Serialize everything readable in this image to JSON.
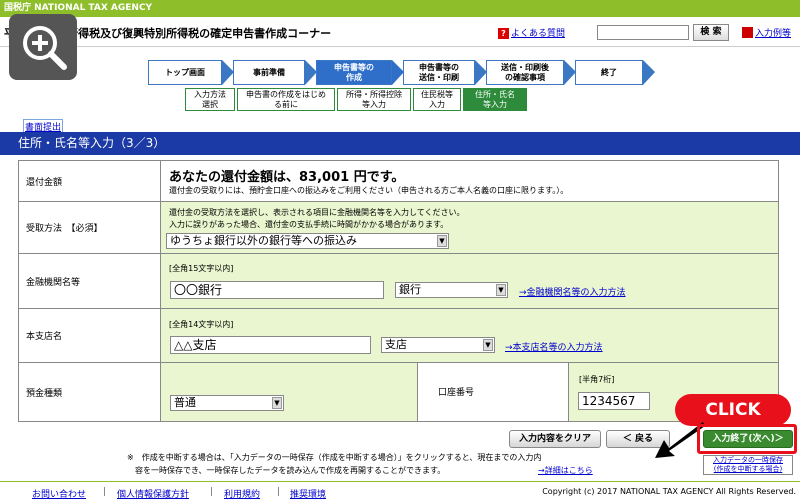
{
  "header": {
    "agency": "国税庁 NATIONAL TAX AGENCY",
    "app_title": "平成29年分 所得税及び復興特別所得税の確定申告書作成コーナー",
    "faq": "よくある質問",
    "search_button": "検 索",
    "input_example": "入力例等"
  },
  "steps": [
    "トップ画面",
    "事前準備",
    "申告書等の\n作成",
    "申告書等の\n送信・印刷",
    "送信・印刷後\nの確認事項",
    "終了"
  ],
  "substeps": [
    "入力方法\n選択",
    "申告書の作成をはじめ\nる前に",
    "所得・所得控除\n等入力",
    "住民税等\n入力",
    "住所・氏名\n等入力"
  ],
  "submission_link": "書面提出",
  "section_title": "住所・氏名等入力（3／3）",
  "refund": {
    "label": "還付金額",
    "amount_text": "あなたの還付金額は、83,001 円です。",
    "note": "還付金の受取りには、預貯金口座への振込みをご利用ください（申告される方ご本人名義の口座に限ります。）。"
  },
  "method": {
    "label": "受取方法　【必須】",
    "note1": "還付金の受取方法を選択し、表示される項目に金融機関名等を入力してください。",
    "note2": "入力に誤りがあった場合、還付金の支払手続に時間がかかる場合があります。",
    "value": "ゆうちょ銀行以外の銀行等への振込み"
  },
  "bank": {
    "label": "金融機関名等",
    "limit": "[全角15文字以内]",
    "value": "〇〇銀行",
    "type": "銀行",
    "help": "→金融機関名等の入力方法"
  },
  "branch": {
    "label": "本支店名",
    "limit": "[全角14文字以内]",
    "value": "△△支店",
    "type": "支店",
    "help": "→本支店名等の入力方法"
  },
  "deposit": {
    "label": "預金種類",
    "type": "普通",
    "account_label": "口座番号",
    "account_limit": "[半角7桁]",
    "account_value": "1234567"
  },
  "buttons": {
    "clear": "入力内容をクリア",
    "back": "＜ 戻る",
    "next": "入力終了(次へ)＞",
    "save": "入力データの一時保存\n(作成を中断する場合)"
  },
  "click_label": "CLICK",
  "interrupt_note1": "※　作成を中断する場合は、「入力データの一時保存（作成を中断する場合）」をクリックすると、現在までの入力内",
  "interrupt_note2": "容を一時保存でき、一時保存したデータを読み込んで作成を再開することができます。",
  "details_link": "→詳細はこちら",
  "footer": {
    "links": [
      "お問い合わせ",
      "個人情報保護方針",
      "利用規約",
      "推奨環境"
    ],
    "copyright": "Copyright (c) 2017 NATIONAL TAX AGENCY All Rights Reserved."
  }
}
